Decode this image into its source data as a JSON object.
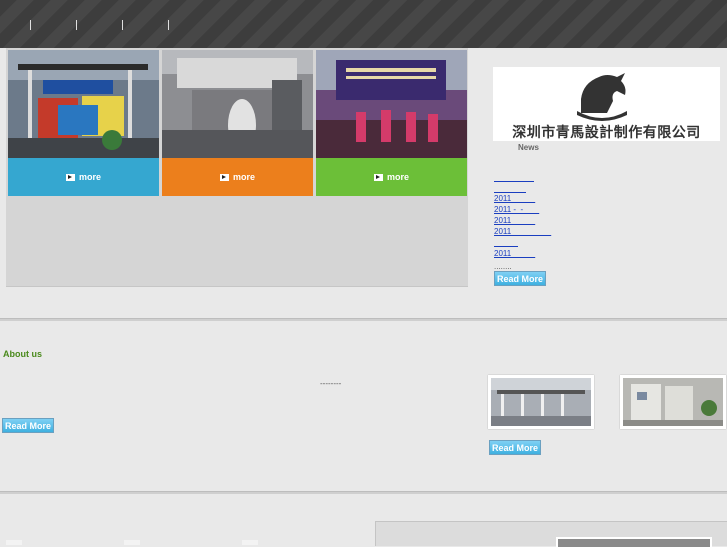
{
  "nav": {
    "items": [
      "",
      "",
      "",
      ""
    ]
  },
  "tiles": [
    {
      "more": "more",
      "color": "#35a7d0"
    },
    {
      "more": "more",
      "color": "#ec7f1c"
    },
    {
      "more": "more",
      "color": "#6cbf38"
    }
  ],
  "company": {
    "name": "深圳市青馬設計制作有限公司"
  },
  "news": {
    "label": "News",
    "items": [
      "　　　　　",
      "　　　　",
      "2011　　　",
      "2011 -  -　　",
      "2011　　　",
      "2011　　　　　",
      "　　　",
      "2011　　　"
    ],
    "more": "........",
    "read_more": "Read More"
  },
  "about": {
    "title": "About us",
    "dashes": "--------",
    "read_more": "Read More"
  },
  "gallery": {
    "read_more": "Read More"
  },
  "colors": {
    "accent_green": "#4a8a1c",
    "link_blue": "#1a3ec0",
    "button_blue": "#3fb0e0"
  }
}
